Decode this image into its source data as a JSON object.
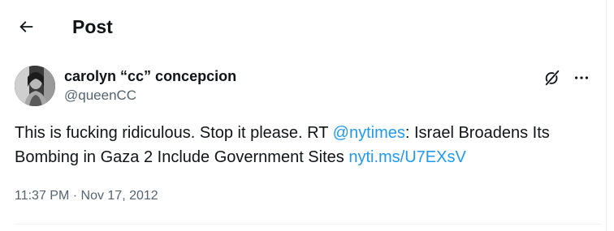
{
  "header": {
    "title": "Post",
    "back_icon": "arrow-left-icon"
  },
  "tweet": {
    "author": {
      "name": "carolyn “cc” concepcion",
      "handle": "@queenCC"
    },
    "actions": {
      "grok_icon": "grok-icon",
      "more_icon": "more-icon"
    },
    "text": {
      "part1": "This is fucking ridiculous. Stop it please. RT ",
      "mention": "@nytimes",
      "part2": ": Israel Broadens Its Bombing in Gaza 2 Include Government Sites ",
      "url": "nyti.ms/U7EXsV"
    },
    "time": "11:37 PM",
    "separator": " · ",
    "date": "Nov 17, 2012"
  },
  "colors": {
    "text": "#0f1419",
    "secondary": "#536471",
    "link": "#1d9bf0",
    "divider": "#eff3f4"
  }
}
